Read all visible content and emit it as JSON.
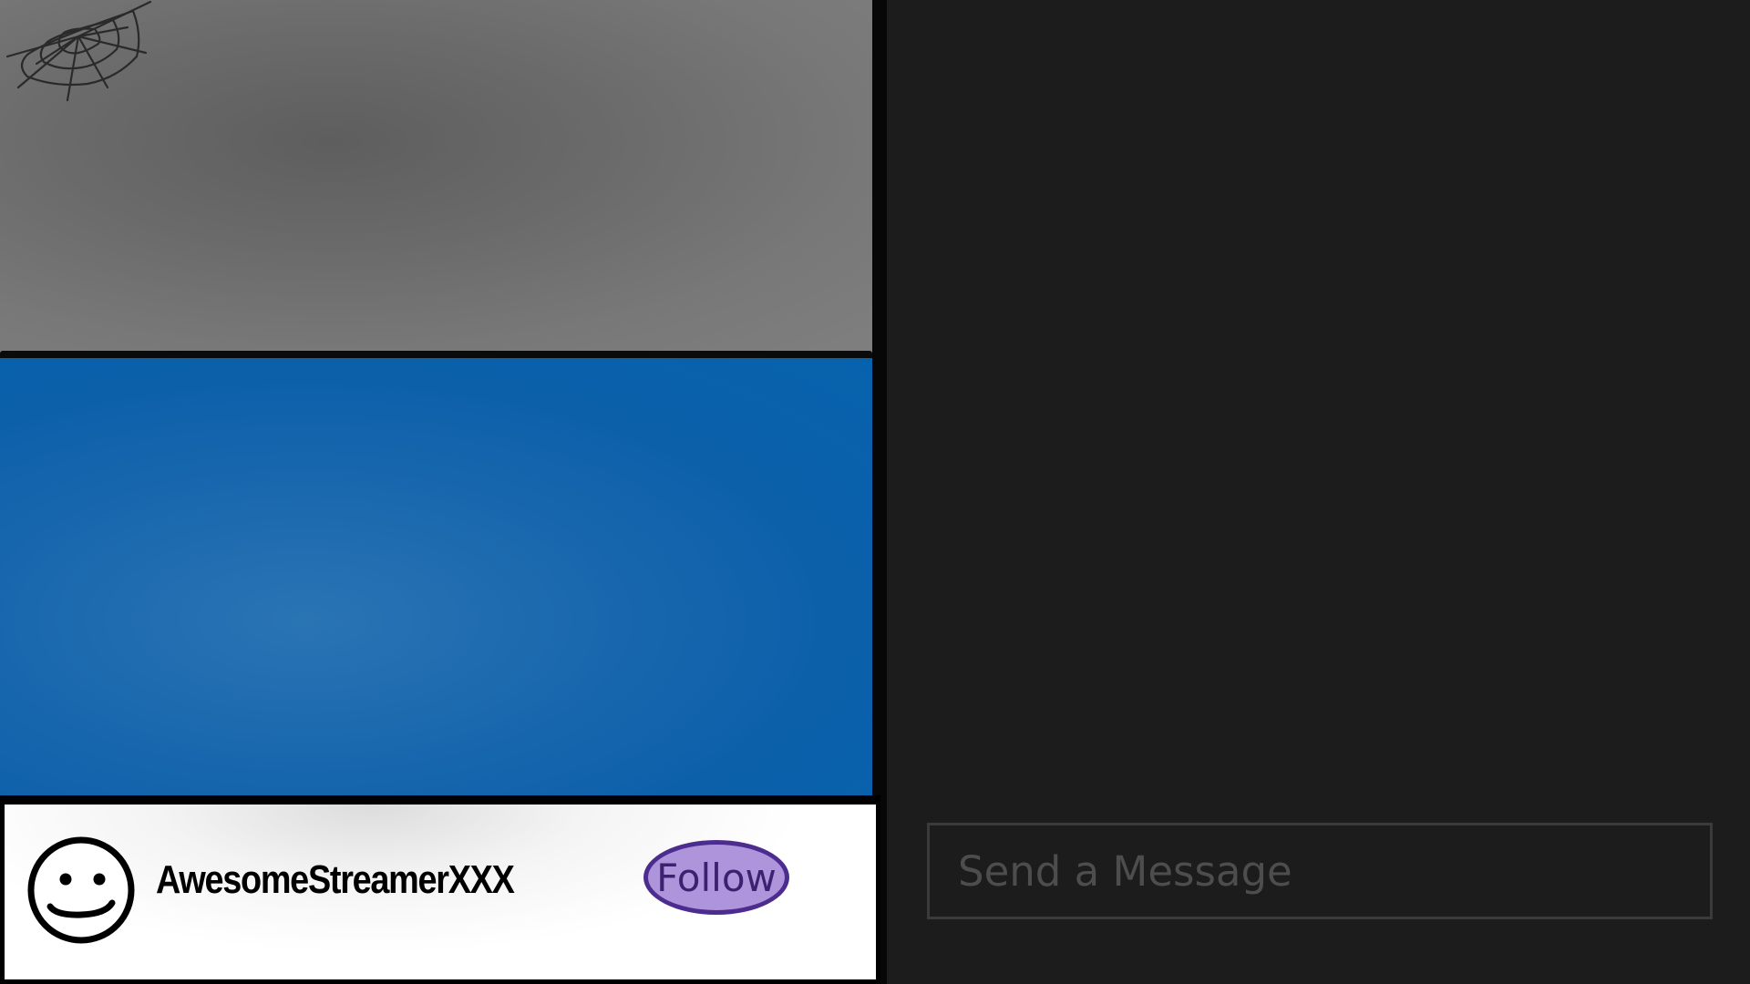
{
  "channel": {
    "streamer_name": "AwesomeStreamerXXX",
    "follow_label": "Follow",
    "avatar_icon": "smiley-face-icon"
  },
  "chat": {
    "input_placeholder": "Send a Message",
    "input_value": ""
  },
  "video": {
    "decoration_icon": "cobweb-icon"
  },
  "colors": {
    "follow_fill": "#ae95db",
    "follow_border": "#4c2c8e",
    "water": "#0762ad",
    "wall": "#6f6f6f",
    "chat_background": "#1c1c1c"
  }
}
